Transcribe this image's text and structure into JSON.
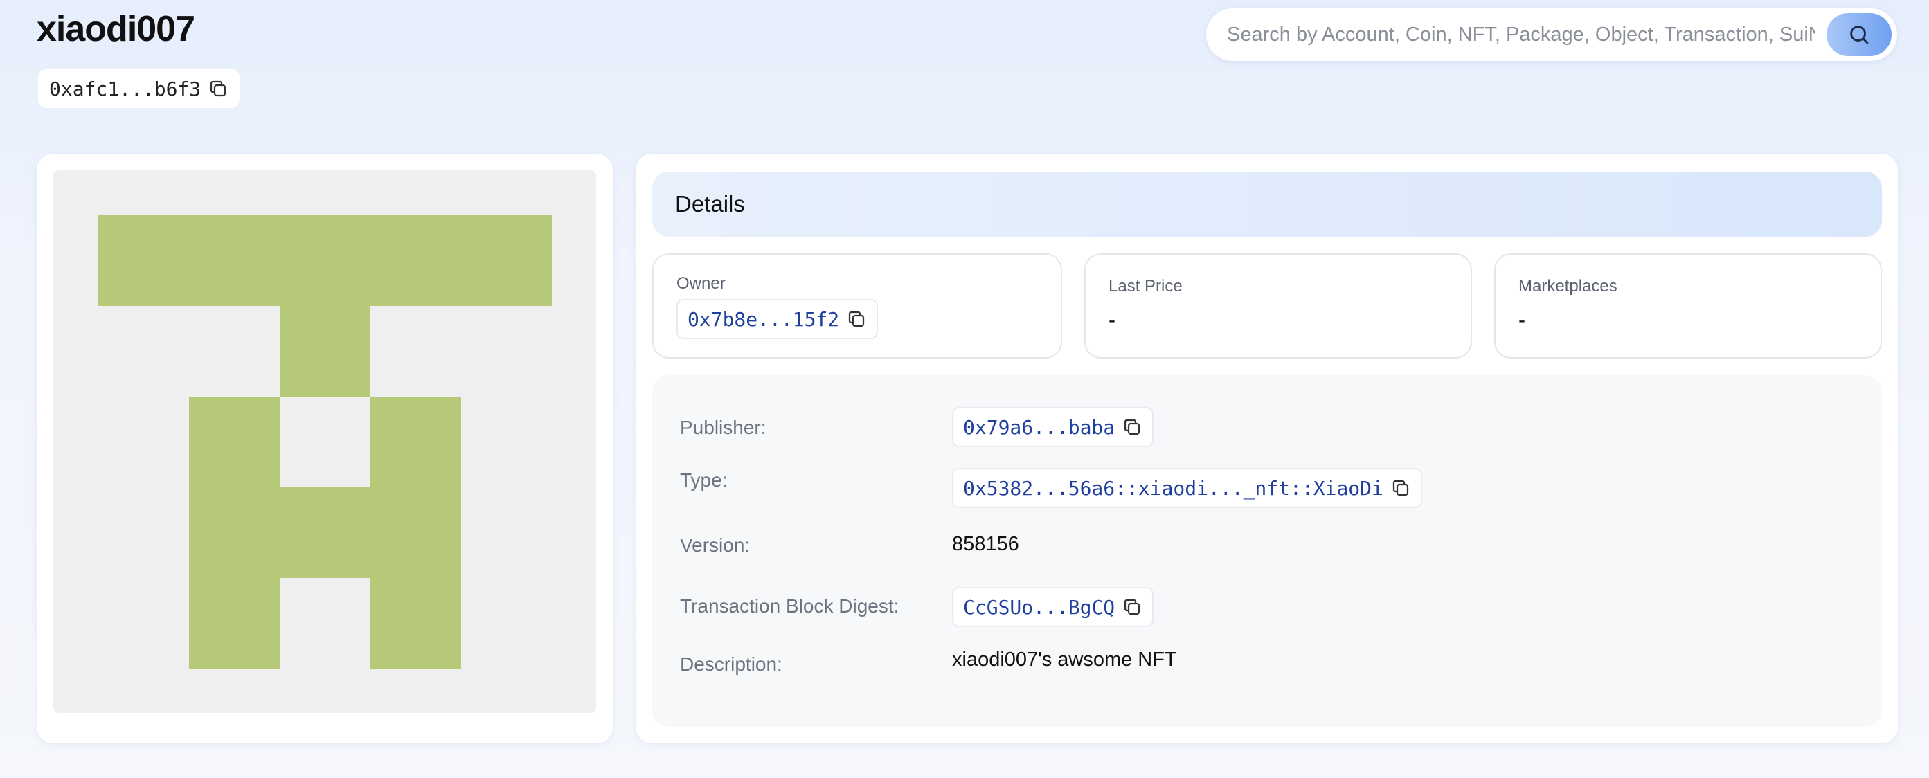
{
  "header": {
    "title": "xiaodi007",
    "object_id": "0xafc1...b6f3"
  },
  "search": {
    "placeholder": "Search by Account, Coin, NFT, Package, Object, Transaction, SuiNS"
  },
  "nft": {
    "image_colors": {
      "background": "#efefef",
      "foreground": "#b5c978"
    }
  },
  "details": {
    "heading": "Details",
    "owner": {
      "label": "Owner",
      "value": "0x7b8e...15f2"
    },
    "last_price": {
      "label": "Last Price",
      "value": "-"
    },
    "marketplaces": {
      "label": "Marketplaces",
      "value": "-"
    },
    "fields": {
      "publisher": {
        "label": "Publisher:",
        "value": "0x79a6...baba"
      },
      "type": {
        "label": "Type:",
        "value": "0x5382...56a6::xiaodi..._nft::XiaoDi"
      },
      "version": {
        "label": "Version:",
        "value": "858156"
      },
      "digest": {
        "label": "Transaction Block Digest:",
        "value": "CcGSUo...BgCQ"
      },
      "description": {
        "label": "Description:",
        "value": "xiaodi007's awsome NFT"
      }
    }
  },
  "colors": {
    "link": "#1f3f9e",
    "accent": "#6fa0ef"
  }
}
